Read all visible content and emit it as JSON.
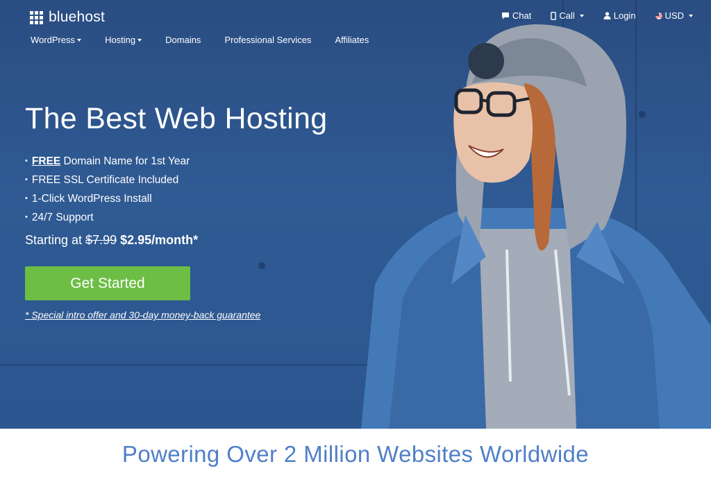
{
  "brand": {
    "name": "bluehost"
  },
  "utility_nav": [
    {
      "label": "Chat",
      "icon": "chat-icon"
    },
    {
      "label": "Call",
      "icon": "phone-icon",
      "has_caret": true
    },
    {
      "label": "Login",
      "icon": "user-icon"
    },
    {
      "label": "USD",
      "icon": "us-flag-icon",
      "has_caret": true
    }
  ],
  "main_nav": [
    {
      "label": "WordPress",
      "has_caret": true
    },
    {
      "label": "Hosting",
      "has_caret": true
    },
    {
      "label": "Domains"
    },
    {
      "label": "Professional Services"
    },
    {
      "label": "Affiliates"
    }
  ],
  "hero": {
    "headline": "The Best Web Hosting",
    "features": {
      "f1_bold": "FREE",
      "f1_rest": " Domain Name for 1st Year",
      "f2": "FREE SSL Certificate Included",
      "f3": "1-Click WordPress Install",
      "f4": "24/7 Support"
    },
    "pricing": {
      "prefix": "Starting at ",
      "old_price": "$7.99",
      "new_price": "$2.95/month*"
    },
    "cta_label": "Get Started",
    "disclaimer": "* Special intro offer and 30-day money-back guarantee"
  },
  "tagline": "Powering Over 2 Million Websites Worldwide",
  "colors": {
    "hero_bg": "#2f5a93",
    "cta": "#6cbe45",
    "tagline": "#4f7fc7"
  }
}
